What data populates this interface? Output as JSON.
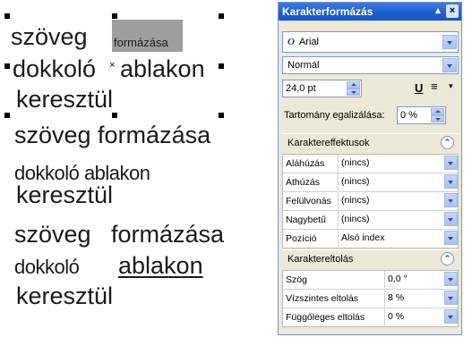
{
  "canvas": {
    "block1": {
      "line1_word1": "szöveg",
      "line1_small": "formázása",
      "line2_word1": "dokkoló",
      "line2_word2": "ablakon",
      "line3": "keresztül"
    },
    "block2": {
      "line1": "szöveg formázása",
      "line2": "dokkoló ablakon",
      "line3": "keresztül"
    },
    "block3": {
      "line1_word1": "szöveg",
      "line1_word2": "formázása",
      "line2_word1": "dokkoló",
      "line2_word2": "ablakon",
      "line3": "keresztül"
    }
  },
  "panel": {
    "title": "Karakterformázás",
    "font_name": "Arial",
    "font_style": "Normál",
    "font_size": "24,0 pt",
    "align_label": "Tartomány egalizálása:",
    "align_value": "0 %",
    "effects_group": {
      "title": "Karaktereffektusok",
      "rows": [
        {
          "name": "Aláhúzás",
          "value": "(nincs)"
        },
        {
          "name": "Áthúzás",
          "value": "(nincs)"
        },
        {
          "name": "Felülvonás",
          "value": "(nincs)"
        },
        {
          "name": "Nagybetű",
          "value": "(nincs)"
        },
        {
          "name": "Pozíció",
          "value": "Alsó index"
        }
      ]
    },
    "shift_group": {
      "title": "Karaktereltolás",
      "rows": [
        {
          "name": "Szög",
          "value": "0,0 °"
        },
        {
          "name": "Vízszintes eltolás",
          "value": "8 %"
        },
        {
          "name": "Függőleges eltolás",
          "value": "0 %"
        }
      ]
    }
  },
  "colors": {
    "titlebar": "#1d5fd0",
    "panel_bg": "#ece9d8",
    "selection_box": "#9e9e9e"
  }
}
